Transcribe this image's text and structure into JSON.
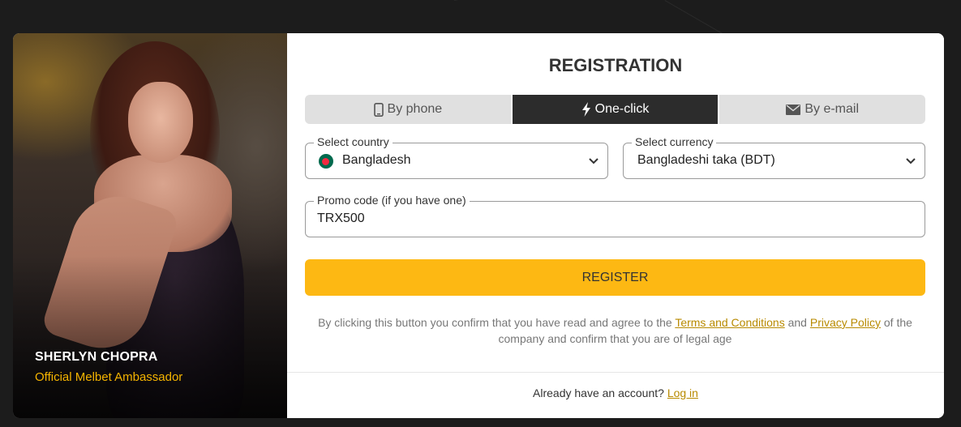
{
  "promo": {
    "name": "SHERLYN CHOPRA",
    "role": "Official Melbet Ambassador"
  },
  "form": {
    "title": "REGISTRATION",
    "tabs": [
      {
        "label": "By phone",
        "icon": "phone-icon",
        "active": false
      },
      {
        "label": "One-click",
        "icon": "lightning-icon",
        "active": true
      },
      {
        "label": "By e-mail",
        "icon": "envelope-icon",
        "active": false
      }
    ],
    "country": {
      "label": "Select country",
      "value": "Bangladesh",
      "flag": "bangladesh-flag-icon"
    },
    "currency": {
      "label": "Select currency",
      "value": "Bangladeshi taka (BDT)"
    },
    "promo_code": {
      "label": "Promo code (if you have one)",
      "value": "TRX500"
    },
    "register_label": "REGISTER",
    "terms": {
      "prefix": "By clicking this button you confirm that you have read and agree to the",
      "terms_link": "Terms and Conditions",
      "and": "and",
      "privacy_link": "Privacy Policy",
      "suffix": "of the company and confirm that you are of legal age"
    },
    "login": {
      "prompt": "Already have an account?",
      "link": "Log in"
    }
  },
  "colors": {
    "accent": "#fdb813",
    "link": "#b88a00",
    "active_tab": "#2c2c2c",
    "ambassador_role": "#f5b400"
  }
}
